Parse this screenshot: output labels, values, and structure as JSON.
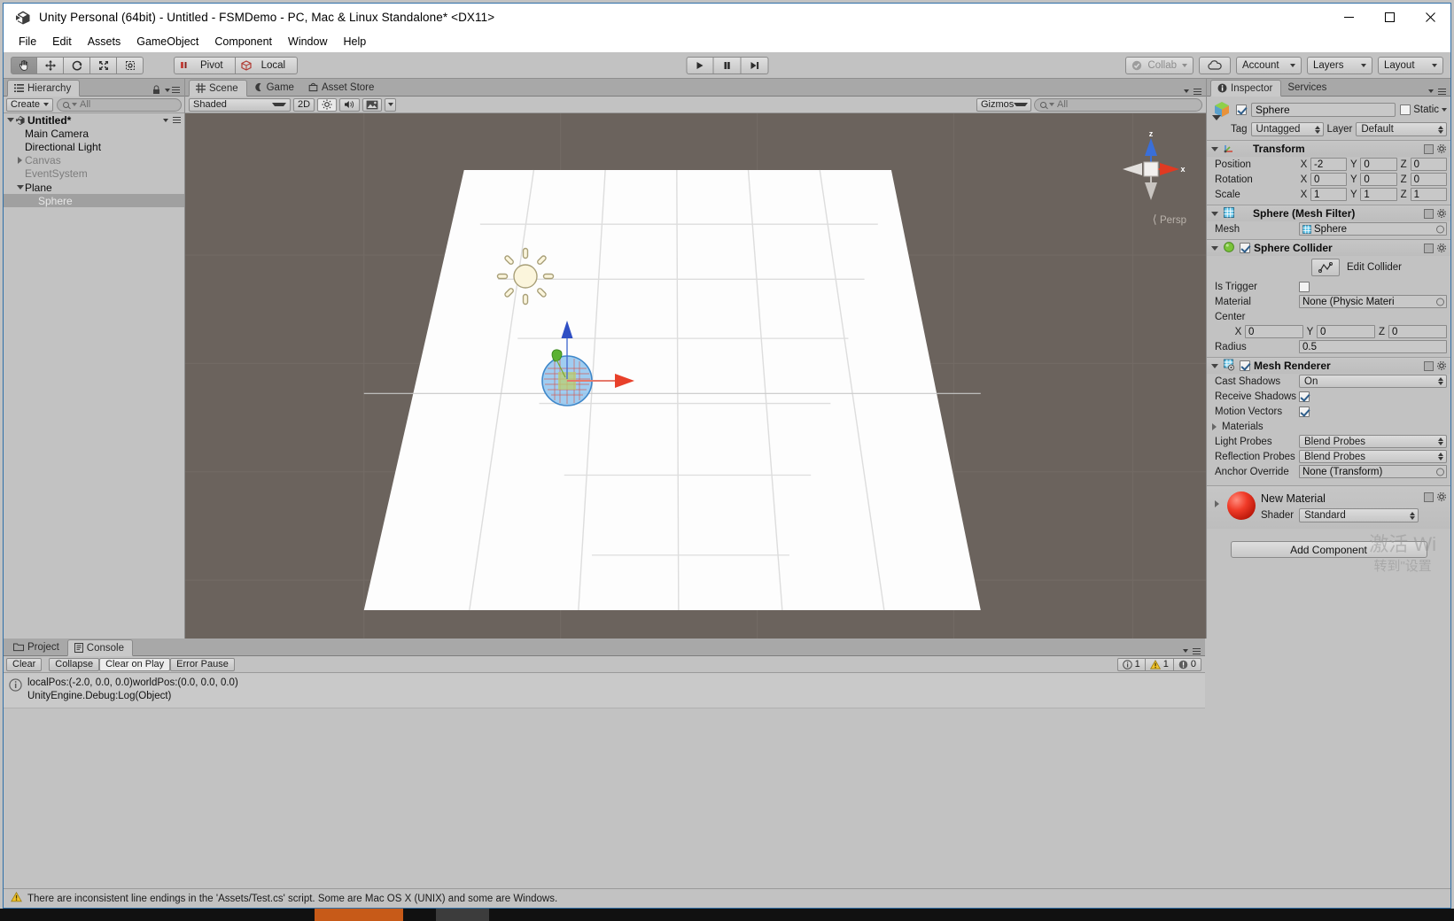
{
  "window": {
    "title": "Unity Personal (64bit) - Untitled - FSMDemo - PC, Mac & Linux Standalone* <DX11>",
    "minimize": "minimize-icon",
    "maximize": "maximize-icon",
    "close": "close-icon"
  },
  "menubar": {
    "items": [
      "File",
      "Edit",
      "Assets",
      "GameObject",
      "Component",
      "Window",
      "Help"
    ]
  },
  "toolbar": {
    "transform_tools": [
      {
        "name": "hand-tool",
        "icon": "hand-icon",
        "active": true
      },
      {
        "name": "move-tool",
        "icon": "move-icon",
        "active": false
      },
      {
        "name": "rotate-tool",
        "icon": "rotate-icon",
        "active": false
      },
      {
        "name": "scale-tool",
        "icon": "scale-icon",
        "active": false
      },
      {
        "name": "rect-tool",
        "icon": "rect-icon",
        "active": false
      }
    ],
    "pivot_label": "Pivot",
    "local_label": "Local",
    "play_label": "play-icon",
    "pause_label": "pause-icon",
    "step_label": "step-icon",
    "collab_label": "Collab",
    "cloud_label": "cloud-icon",
    "account_label": "Account",
    "layers_label": "Layers",
    "layout_label": "Layout"
  },
  "hierarchy": {
    "tab_label": "Hierarchy",
    "create_label": "Create",
    "search_placeholder": "All",
    "scene_name": "Untitled*",
    "items": [
      {
        "label": "Main Camera",
        "depth": 1,
        "expandable": false,
        "inactive": false,
        "selected": false
      },
      {
        "label": "Directional Light",
        "depth": 1,
        "expandable": false,
        "inactive": false,
        "selected": false
      },
      {
        "label": "Canvas",
        "depth": 1,
        "expandable": true,
        "inactive": true,
        "selected": false
      },
      {
        "label": "EventSystem",
        "depth": 1,
        "expandable": false,
        "inactive": true,
        "selected": false
      },
      {
        "label": "Plane",
        "depth": 1,
        "expandable": true,
        "expanded": true,
        "inactive": false,
        "selected": false
      },
      {
        "label": "Sphere",
        "depth": 2,
        "expandable": false,
        "inactive": false,
        "selected": true
      }
    ]
  },
  "sceneview": {
    "tabs": [
      {
        "label": "Scene",
        "icon": "scene-grid-icon",
        "active": true
      },
      {
        "label": "Game",
        "icon": "game-pad-icon",
        "active": false
      },
      {
        "label": "Asset Store",
        "icon": "store-icon",
        "active": false
      }
    ],
    "shading_mode": "Shaded",
    "two_d_label": "2D",
    "lighting_icon": "sun-icon",
    "audio_icon": "speaker-icon",
    "fx_icon": "image-icon",
    "gizmos_label": "Gizmos",
    "search_placeholder": "All",
    "axis_z": "z",
    "axis_x": "x",
    "projection_label": "Persp"
  },
  "console": {
    "tabs": [
      {
        "label": "Project",
        "icon": "folder-icon",
        "active": false
      },
      {
        "label": "Console",
        "icon": "console-icon",
        "active": true
      }
    ],
    "clear_label": "Clear",
    "collapse_label": "Collapse",
    "clear_on_play_label": "Clear on Play",
    "error_pause_label": "Error Pause",
    "counts": {
      "info": "1",
      "warning": "1",
      "error": "0"
    },
    "entries": [
      {
        "icon": "info-icon",
        "line1": "localPos:(-2.0, 0.0, 0.0)worldPos:(0.0, 0.0, 0.0)",
        "line2": "UnityEngine.Debug:Log(Object)"
      }
    ]
  },
  "inspector": {
    "tabs": [
      {
        "label": "Inspector",
        "icon": "info-circle-icon",
        "active": true
      },
      {
        "label": "Services",
        "icon": "services-icon",
        "active": false
      }
    ],
    "object_name": "Sphere",
    "object_enabled": true,
    "static_label": "Static",
    "static_checked": false,
    "tag_label": "Tag",
    "tag_value": "Untagged",
    "layer_label": "Layer",
    "layer_value": "Default",
    "components": [
      {
        "name": "transform",
        "title": "Transform",
        "icon": "transform-icon",
        "rows": [
          {
            "label": "Position",
            "type": "vector3",
            "x": "-2",
            "y": "0",
            "z": "0"
          },
          {
            "label": "Rotation",
            "type": "vector3",
            "x": "0",
            "y": "0",
            "z": "0"
          },
          {
            "label": "Scale",
            "type": "vector3",
            "x": "1",
            "y": "1",
            "z": "1"
          }
        ]
      },
      {
        "name": "mesh-filter",
        "title": "Sphere (Mesh Filter)",
        "icon": "mesh-filter-icon",
        "rows": [
          {
            "label": "Mesh",
            "type": "object",
            "value": "Sphere",
            "value_icon": "mesh-icon"
          }
        ]
      },
      {
        "name": "sphere-collider",
        "title": "Sphere Collider",
        "icon": "collider-icon",
        "has_checkbox": true,
        "checked": true,
        "edit_collider_label": "Edit Collider",
        "rows": [
          {
            "label": "Is Trigger",
            "type": "checkbox",
            "checked": false
          },
          {
            "label": "Material",
            "type": "object",
            "value": "None (Physic Materi"
          },
          {
            "label": "Center",
            "type": "label"
          },
          {
            "label": "",
            "type": "vector3",
            "x": "0",
            "y": "0",
            "z": "0"
          },
          {
            "label": "Radius",
            "type": "text",
            "value": "0.5"
          }
        ]
      },
      {
        "name": "mesh-renderer",
        "title": "Mesh Renderer",
        "icon": "mesh-renderer-icon",
        "has_checkbox": true,
        "checked": true,
        "rows": [
          {
            "label": "Cast Shadows",
            "type": "enum",
            "value": "On"
          },
          {
            "label": "Receive Shadows",
            "type": "checkbox",
            "checked": true
          },
          {
            "label": "Motion Vectors",
            "type": "checkbox",
            "checked": true
          },
          {
            "label": "Materials",
            "type": "foldout"
          },
          {
            "label": "Light Probes",
            "type": "enum",
            "value": "Blend Probes"
          },
          {
            "label": "Reflection Probes",
            "type": "enum",
            "value": "Blend Probes"
          },
          {
            "label": "Anchor Override",
            "type": "object",
            "value": "None (Transform)"
          }
        ]
      }
    ],
    "material": {
      "name": "New Material",
      "shader_label": "Shader",
      "shader_value": "Standard",
      "preview_color": "#e03020"
    },
    "add_component_label": "Add Component"
  },
  "statusbar": {
    "icon": "warning-icon",
    "message": "There are inconsistent line endings in the 'Assets/Test.cs' script. Some are Mac OS X (UNIX) and some are Windows."
  },
  "watermark": {
    "line1": "激活 Wi",
    "line2": "转到\"设置"
  },
  "colors": {
    "panel_bg": "#c2c2c2",
    "scene_bg": "#6b635d",
    "selection": "#a0a0a0",
    "accent_blue": "#2f6fa8",
    "axis_x": "#e8402a",
    "axis_y": "#57b030",
    "axis_z": "#3355dd"
  }
}
